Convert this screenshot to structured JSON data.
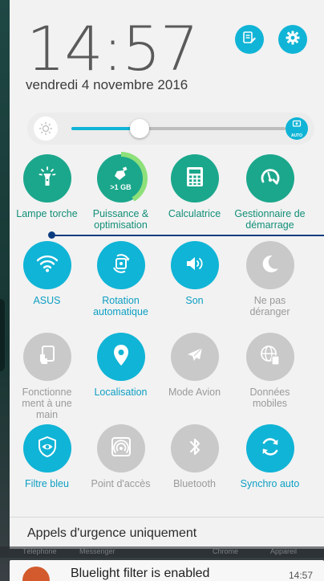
{
  "clock": {
    "time": "14:57",
    "date": "vendredi 4 novembre 2016"
  },
  "header_buttons": [
    {
      "name": "edit-quick-settings",
      "icon": "edit-list-icon"
    },
    {
      "name": "settings",
      "icon": "gear-icon"
    }
  ],
  "brightness": {
    "level": 0.32,
    "auto_badge": "AUTO"
  },
  "tiles": [
    {
      "id": "flashlight",
      "label": "Lampe torche",
      "state": "on-teal",
      "icon": "flashlight-icon"
    },
    {
      "id": "power-optimization",
      "label": "Puissance & optimisation",
      "state": "on-teal",
      "icon": "broom-icon",
      "badge": ">1 GB"
    },
    {
      "id": "calculator",
      "label": "Calculatrice",
      "state": "on-teal",
      "icon": "calculator-icon"
    },
    {
      "id": "startup-manager",
      "label": "Gestionnaire de démarrage",
      "state": "on-teal",
      "icon": "gauge-wrench-icon"
    },
    {
      "id": "wifi",
      "label": "ASUS",
      "state": "on-blue",
      "icon": "wifi-icon"
    },
    {
      "id": "auto-rotate",
      "label": "Rotation automatique",
      "state": "on-blue",
      "icon": "rotate-icon"
    },
    {
      "id": "sound",
      "label": "Son",
      "state": "on-blue",
      "icon": "volume-icon"
    },
    {
      "id": "do-not-disturb",
      "label": "Ne pas déranger",
      "state": "off",
      "icon": "moon-icon"
    },
    {
      "id": "one-hand-mode",
      "label": "Fonctionne ment à une main",
      "state": "off",
      "icon": "one-hand-icon"
    },
    {
      "id": "location",
      "label": "Localisation",
      "state": "on-blue",
      "icon": "location-pin-icon"
    },
    {
      "id": "airplane-mode",
      "label": "Mode Avion",
      "state": "off",
      "icon": "airplane-icon"
    },
    {
      "id": "mobile-data",
      "label": "Données mobiles",
      "state": "off",
      "icon": "globe-icon"
    },
    {
      "id": "blue-filter",
      "label": "Filtre bleu",
      "state": "on-blue",
      "icon": "eye-shield-icon"
    },
    {
      "id": "hotspot",
      "label": "Point d'accès",
      "state": "off",
      "icon": "hotspot-icon"
    },
    {
      "id": "bluetooth",
      "label": "Bluetooth",
      "state": "off",
      "icon": "bluetooth-icon"
    },
    {
      "id": "auto-sync",
      "label": "Synchro auto",
      "state": "on-blue",
      "icon": "sync-icon"
    }
  ],
  "emergency_text": "Appels d'urgence uniquement",
  "dock_labels": [
    "Téléphone",
    "Messenger",
    "Chrome",
    "Appareil"
  ],
  "notification": {
    "title": "Bluelight filter is enabled",
    "time": "14:57"
  },
  "colors": {
    "teal": "#1ba78c",
    "blue": "#10b4d6",
    "grey": "#c9c9c9",
    "panel": "#f2f2f2"
  }
}
